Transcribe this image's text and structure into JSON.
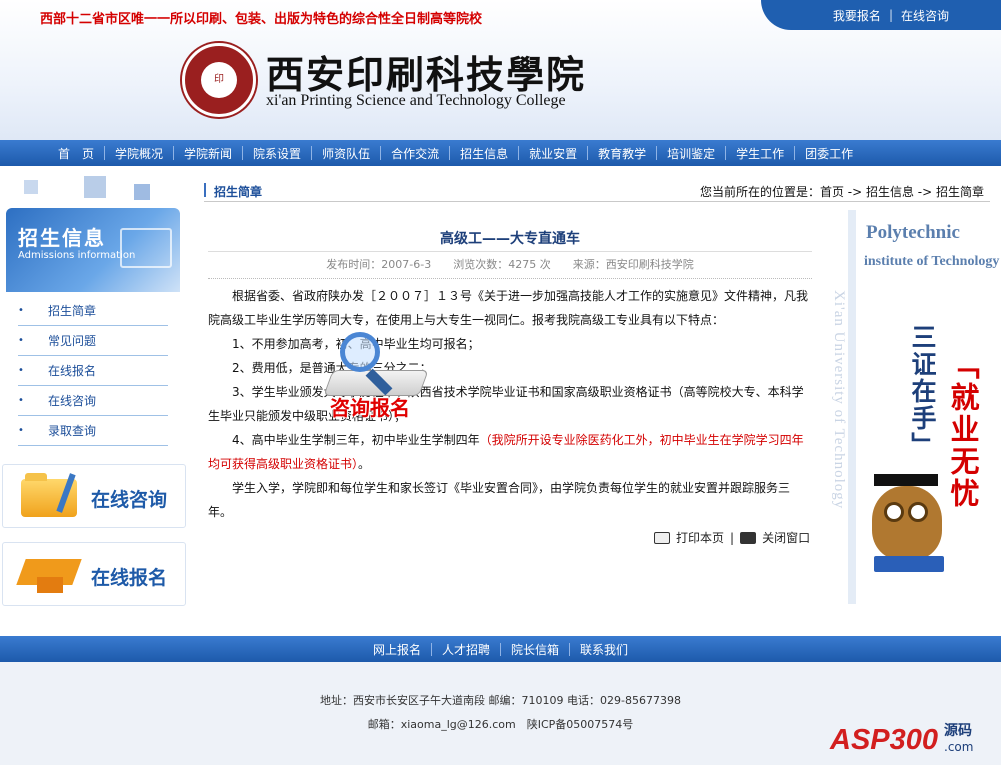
{
  "header": {
    "slogan": "西部十二省市区唯一一所以印刷、包装、出版为特色的综合性全日制高等院校",
    "top_links": [
      "我要报名",
      "在线咨询"
    ],
    "logo_cn": "西安印刷科技學院",
    "logo_en": "xi'an Printing Science and Technology College"
  },
  "nav": [
    "首　页",
    "学院概况",
    "学院新闻",
    "院系设置",
    "师资队伍",
    "合作交流",
    "招生信息",
    "就业安置",
    "教育教学",
    "培训鉴定",
    "学生工作",
    "团委工作"
  ],
  "sidebar": {
    "box_title": "招生信息",
    "box_subtitle": "Admissions information",
    "items": [
      "招生简章",
      "常见问题",
      "在线报名",
      "在线咨询",
      "录取查询"
    ],
    "btn_consult": "在线咨询",
    "btn_signup": "在线报名"
  },
  "content": {
    "section_title": "招生简章",
    "breadcrumb": "您当前所在的位置是：首页 -> 招生信息 -> 招生简章",
    "title": "高级工——大专直通车",
    "meta": "发布时间：2007-6-3　　浏览次数：4275 次　　来源：西安印刷科技学院",
    "p1": "根据省委、省政府陕办发［２００７］１３号《关于进一步加强高技能人才工作的实施意见》文件精神，凡我院高级工毕业生学历等同大专，在使用上与大专生一视同仁。报考我院高级工专业具有以下特点：",
    "p2": "1、不用参加高考，初、高中毕业生均可报名；",
    "p3": "2、费用低，是普通大专的三分之二；",
    "p4": "3、学生毕业颁发大专学历证书、陕西省技术学院毕业证书和国家高级职业资格证书（高等院校大专、本科学生毕业只能颁发中级职业资格证书）；",
    "p5a": "4、高中毕业生学制三年，初中毕业生学制四年",
    "p5b": "（我院所开设专业除医药化工外，初中毕业生在学院学习四年均可获得高级职业资格证书）",
    "p5c": "。",
    "p6": "学生入学，学院即和每位学生和家长签订《毕业安置合同》，由学院负责每位学生的就业安置并跟踪服务三年。",
    "print_label": "打印本页",
    "close_label": "关闭窗口"
  },
  "overlay": {
    "label": "咨询报名"
  },
  "banner": {
    "line1": "Polytechnic",
    "line2": "institute of Technology",
    "vertical_en": "Xi'an University of Technology",
    "slogan_left": "三证在手」",
    "slogan_right": "「就业无忧"
  },
  "footer": {
    "links": [
      "网上报名",
      "人才招聘",
      "院长信箱",
      "联系我们"
    ],
    "address": "地址：西安市长安区子午大道南段 邮编：710109 电话：029-85677398",
    "email": "邮箱：xiaoma_lg@126.com　陕ICP备05007574号"
  },
  "watermark": {
    "brand": "ASP300",
    "cn": "源码",
    "domain": ".com"
  }
}
